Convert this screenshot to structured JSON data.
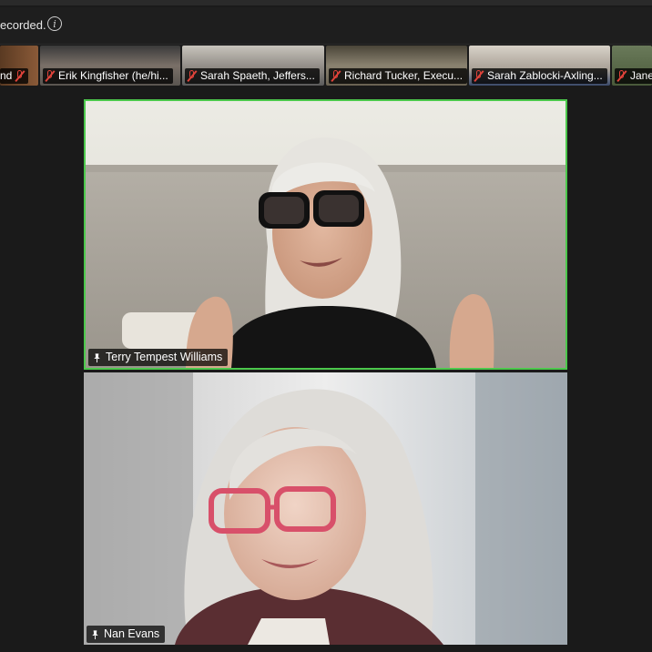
{
  "banner": {
    "text": "ecorded.",
    "info_icon": "info-icon"
  },
  "participants_strip": [
    {
      "name": "nd",
      "muted": true,
      "bg": "#6a4a30"
    },
    {
      "name": "Erik Kingfisher (he/hi...",
      "muted": true,
      "bg": "#8a8178"
    },
    {
      "name": "Sarah Spaeth, Jeffers...",
      "muted": true,
      "bg": "#9a9590"
    },
    {
      "name": "Richard Tucker, Execu...",
      "muted": true,
      "bg": "#7c7568"
    },
    {
      "name": "Sarah Zablocki-Axling...",
      "muted": true,
      "bg": "#a9a196"
    },
    {
      "name": "Jane",
      "muted": true,
      "bg": "#556b4a"
    }
  ],
  "main_speakers": [
    {
      "name": "Terry Tempest Williams",
      "active_speaker": true,
      "pin_icon": "pin-icon"
    },
    {
      "name": "Nan Evans",
      "active_speaker": false,
      "pin_icon": "pin-icon"
    }
  ],
  "colors": {
    "active_border": "#4cc84c",
    "muted_icon": "#e0433a",
    "background": "#1a1a1a"
  }
}
